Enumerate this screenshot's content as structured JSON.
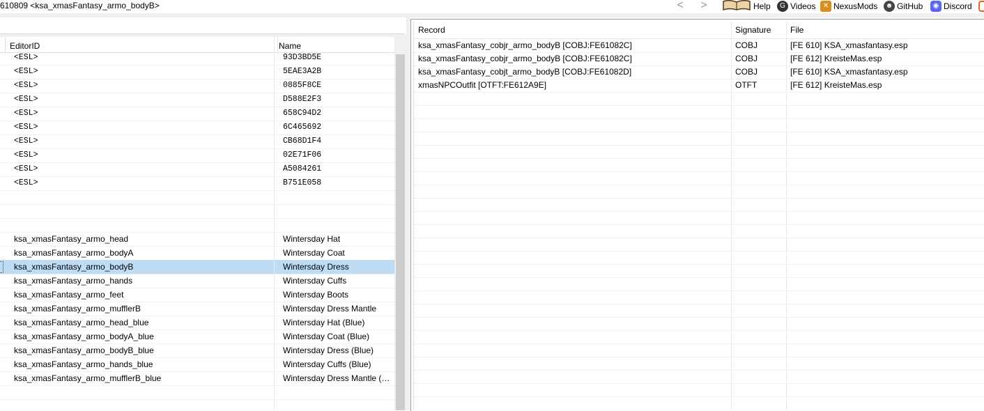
{
  "window": {
    "title": "610809 <ksa_xmasFantasy_armo_bodyB>",
    "nav_back": "<",
    "nav_forward": ">"
  },
  "toolbar": {
    "items": [
      {
        "label": "Help",
        "icon": "book-icon"
      },
      {
        "label": "Videos",
        "icon": "gp-icon"
      },
      {
        "label": "NexusMods",
        "icon": "nexusmods-icon"
      },
      {
        "label": "GitHub",
        "icon": "github-icon"
      },
      {
        "label": "Discord",
        "icon": "discord-icon"
      }
    ]
  },
  "left_table": {
    "headers": {
      "editor_id": "EditorID",
      "name": "Name"
    },
    "esl_rows": [
      {
        "editor_id": "<ESL>",
        "name": "93D3BD5E"
      },
      {
        "editor_id": "<ESL>",
        "name": "5EAE3A2B"
      },
      {
        "editor_id": "<ESL>",
        "name": "0885F8CE"
      },
      {
        "editor_id": "<ESL>",
        "name": "D588E2F3"
      },
      {
        "editor_id": "<ESL>",
        "name": "658C94D2"
      },
      {
        "editor_id": "<ESL>",
        "name": "6C465692"
      },
      {
        "editor_id": "<ESL>",
        "name": "CB68D1F4"
      },
      {
        "editor_id": "<ESL>",
        "name": "02E71F06"
      },
      {
        "editor_id": "<ESL>",
        "name": "A5084261"
      },
      {
        "editor_id": "<ESL>",
        "name": "B751E058"
      }
    ],
    "armo_rows": [
      {
        "editor_id": "ksa_xmasFantasy_armo_head",
        "name": "Wintersday Hat"
      },
      {
        "editor_id": "ksa_xmasFantasy_armo_bodyA",
        "name": "Wintersday Coat"
      },
      {
        "editor_id": "ksa_xmasFantasy_armo_bodyB",
        "name": "Wintersday Dress",
        "selected": true
      },
      {
        "editor_id": "ksa_xmasFantasy_armo_hands",
        "name": "Wintersday Cuffs"
      },
      {
        "editor_id": "ksa_xmasFantasy_armo_feet",
        "name": "Wintersday Boots"
      },
      {
        "editor_id": "ksa_xmasFantasy_armo_mufflerB",
        "name": "Wintersday Dress Mantle"
      },
      {
        "editor_id": "ksa_xmasFantasy_armo_head_blue",
        "name": "Wintersday Hat (Blue)"
      },
      {
        "editor_id": "ksa_xmasFantasy_armo_bodyA_blue",
        "name": "Wintersday Coat (Blue)"
      },
      {
        "editor_id": "ksa_xmasFantasy_armo_bodyB_blue",
        "name": "Wintersday Dress (Blue)"
      },
      {
        "editor_id": "ksa_xmasFantasy_armo_hands_blue",
        "name": "Wintersday Cuffs (Blue)"
      },
      {
        "editor_id": "ksa_xmasFantasy_armo_mufflerB_blue",
        "name": "Wintersday Dress Mantle (B..."
      }
    ]
  },
  "right_table": {
    "headers": {
      "record": "Record",
      "signature": "Signature",
      "file": "File"
    },
    "rows": [
      {
        "record": "ksa_xmasFantasy_cobjr_armo_bodyB [COBJ:FE61082C]",
        "signature": "COBJ",
        "file": "[FE 610] KSA_xmasfantasy.esp"
      },
      {
        "record": "ksa_xmasFantasy_cobjr_armo_bodyB [COBJ:FE61082C]",
        "signature": "COBJ",
        "file": "[FE 612] KreisteMas.esp"
      },
      {
        "record": "ksa_xmasFantasy_cobjt_armo_bodyB [COBJ:FE61082D]",
        "signature": "COBJ",
        "file": "[FE 610] KSA_xmasfantasy.esp"
      },
      {
        "record": "xmasNPCOutfit [OTFT:FE612A9E]",
        "signature": "OTFT",
        "file": "[FE 612] KreisteMas.esp"
      }
    ]
  },
  "colors": {
    "selection": "#bfdcf5",
    "panel_bg": "#f0f0f0",
    "scroll_thumb": "#cdcdcd"
  }
}
